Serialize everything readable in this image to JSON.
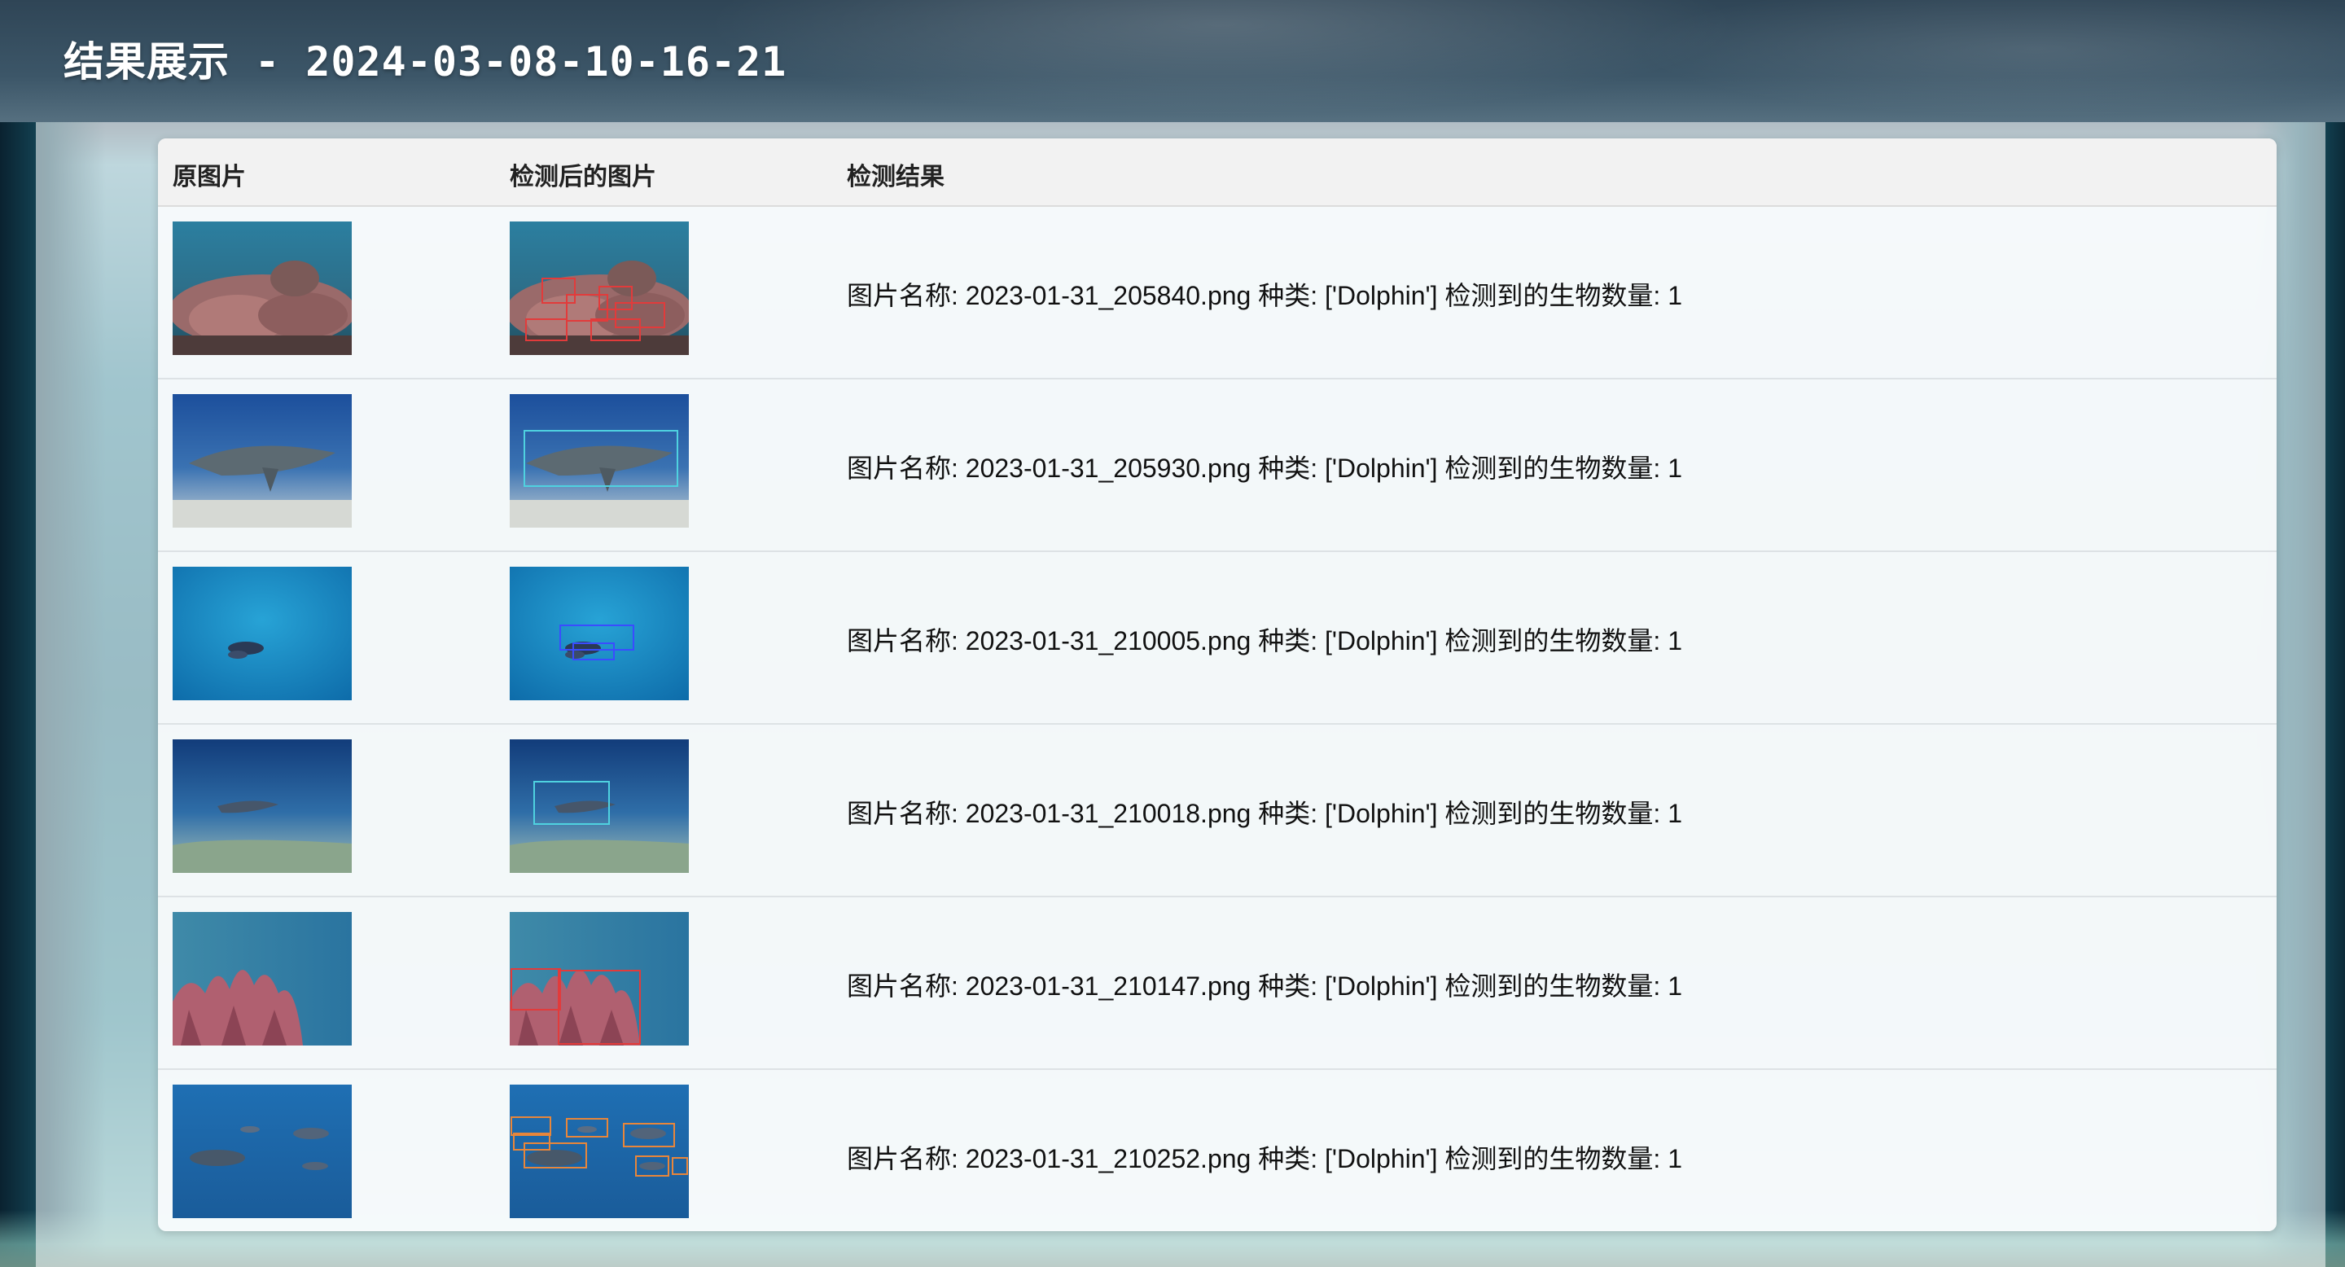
{
  "page": {
    "title": "结果展示 - 2024-03-08-10-16-21"
  },
  "table": {
    "headers": {
      "original": "原图片",
      "detected": "检测后的图片",
      "result": "检测结果"
    },
    "rows": [
      {
        "scene": "coral",
        "result": "图片名称: 2023-01-31_205840.png 种类: ['Dolphin'] 检测到的生物数量: 1"
      },
      {
        "scene": "shark",
        "result": "图片名称: 2023-01-31_205930.png 种类: ['Dolphin'] 检测到的生物数量: 1"
      },
      {
        "scene": "diver",
        "result": "图片名称: 2023-01-31_210005.png 种类: ['Dolphin'] 检测到的生物数量: 1"
      },
      {
        "scene": "hammerhead",
        "result": "图片名称: 2023-01-31_210018.png 种类: ['Dolphin'] 检测到的生物数量: 1"
      },
      {
        "scene": "pink-coral",
        "result": "图片名称: 2023-01-31_210147.png 种类: ['Dolphin'] 检测到的生物数量: 1"
      },
      {
        "scene": "dolphins",
        "result": "图片名称: 2023-01-31_210252.png 种类: ['Dolphin'] 检测到的生物数量: 1"
      }
    ]
  },
  "colors": {
    "header_bg": "#f2f2f2",
    "row_border": "#dde2e5",
    "box_red": "#e23b3b",
    "box_cyan": "#4fd2e0",
    "box_blue": "#3a4cff",
    "box_orange": "#e8863a"
  }
}
